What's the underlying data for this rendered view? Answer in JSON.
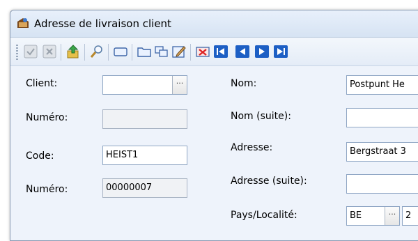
{
  "window": {
    "title": "Adresse de livraison client"
  },
  "toolbar": {
    "buttons": [
      "confirm-icon",
      "cancel-icon",
      "export-icon",
      "search-icon",
      "rectangle-icon",
      "folder-icon",
      "copy-icon",
      "edit-icon",
      "delete-icon",
      "first-icon",
      "prev-icon",
      "next-icon",
      "last-icon"
    ]
  },
  "form": {
    "client_label": "Client:",
    "client_value": "",
    "client_button": "···",
    "numero1_label": "Numéro:",
    "numero1_value": "",
    "code_label": "Code:",
    "code_value": "HEIST1",
    "numero2_label": "Numéro:",
    "numero2_value": "00000007",
    "nom_label": "Nom:",
    "nom_value": "Postpunt He",
    "nom_suite_label": "Nom (suite):",
    "nom_suite_value": "",
    "adresse_label": "Adresse:",
    "adresse_value": "Bergstraat 3",
    "adresse_suite_label": "Adresse (suite):",
    "adresse_suite_value": "",
    "pays_label": "Pays/Localité:",
    "pays_value": "BE",
    "pays_button": "···",
    "localite_value": "2"
  }
}
